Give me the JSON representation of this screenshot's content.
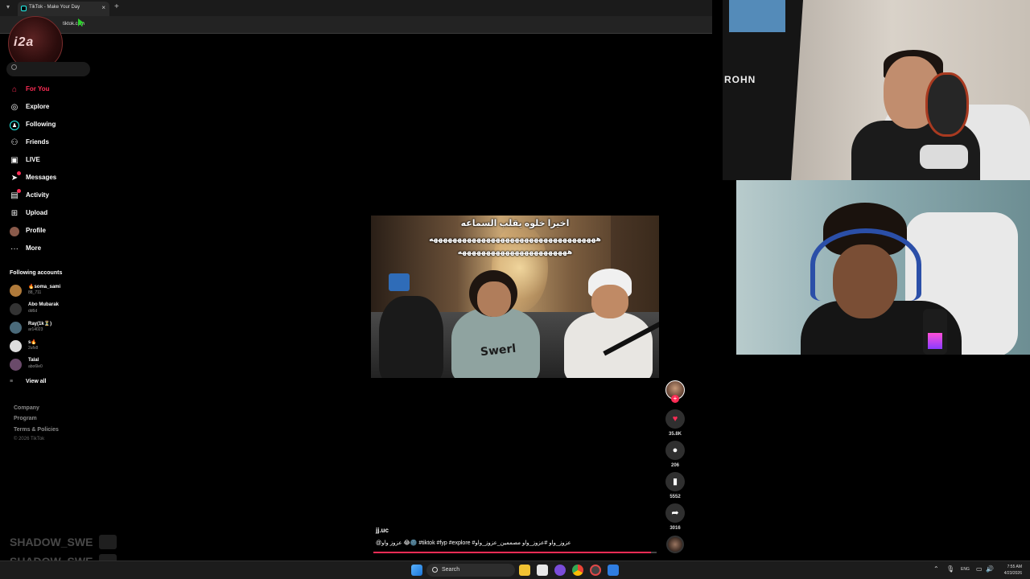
{
  "browser": {
    "tab_title": "TikTok - Make Your Day",
    "url": "tiktok.com",
    "new_tab_glyph": "+",
    "close_glyph": "×"
  },
  "overlay": {
    "logo_text": "i2a"
  },
  "sidebar": {
    "nav": [
      {
        "label": "For You",
        "icon": "home-icon"
      },
      {
        "label": "Explore",
        "icon": "compass-icon"
      },
      {
        "label": "Following",
        "icon": "following-icon"
      },
      {
        "label": "Friends",
        "icon": "friends-icon"
      },
      {
        "label": "LIVE",
        "icon": "live-icon"
      },
      {
        "label": "Messages",
        "icon": "messages-icon"
      },
      {
        "label": "Activity",
        "icon": "activity-icon"
      },
      {
        "label": "Upload",
        "icon": "upload-icon"
      },
      {
        "label": "Profile",
        "icon": "profile-icon"
      },
      {
        "label": "More",
        "icon": "more-icon"
      }
    ],
    "following_title": "Following accounts",
    "accounts": [
      {
        "name": "🔥soma_sami",
        "handle": "88_711"
      },
      {
        "name": "Abo Mubarak",
        "handle": "dd6d"
      },
      {
        "name": "Ray(1k⏳)",
        "handle": "ar14023"
      },
      {
        "name": "s🔥",
        "handle": "2ufx8"
      },
      {
        "name": "Talal",
        "handle": "abo6le0"
      }
    ],
    "view_all": "View all",
    "footer": [
      "Company",
      "Program",
      "Terms & Policies"
    ],
    "copyright": "© 2026 TikTok"
  },
  "video": {
    "caption_line1": "اخيرا خلوه يقلب السماعه",
    "caption_line2": "هههههههههههههههههههههههههههههههههههه",
    "caption_line3": "هههههههههههههههههههههههه",
    "shirt_text": "Swerl",
    "author": "jj.uc",
    "description": "@عزوز واو 😂🌚 #tiktok #fyp #explore #عزوز_واو #عزوز_واو مصممين_عزوز_واو",
    "progress": 0.98
  },
  "actions": {
    "likes": "35.8K",
    "comments": "206",
    "saves": "5552",
    "shares": "3016"
  },
  "watermark": {
    "line1": "SHADOW_SWE",
    "line2": "SHADOW_SWE"
  },
  "webcam": {
    "jersey_text": "ROHN"
  },
  "taskbar": {
    "search_label": "Search",
    "lang": "ENG",
    "time": "7:55 AM",
    "date": "4/23/2026"
  },
  "colors": {
    "accent": "#fe2c55",
    "background": "#000000"
  }
}
